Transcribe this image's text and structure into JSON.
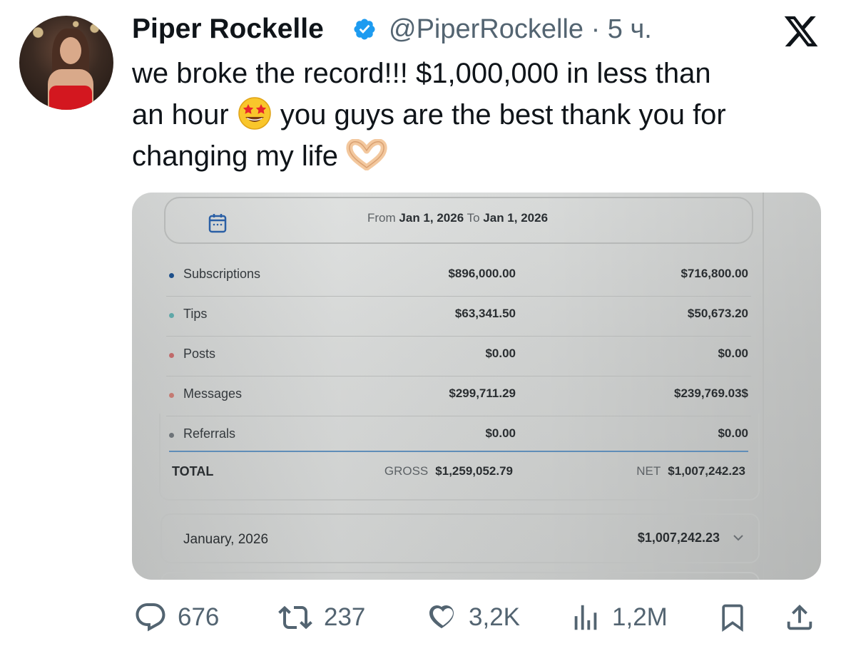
{
  "author": {
    "name": "Piper Rockelle",
    "handle": "@PiperRockelle",
    "time": "5 ч.",
    "separator": "·",
    "verified": true
  },
  "tweet": {
    "line1": "we broke the record!!! $1,000,000 in less than",
    "line2_a": "an hour",
    "line2_emoji": "star-struck-emoji",
    "line2_b": "you guys are the best thank you for",
    "line3": "changing my life",
    "line3_emoji": "heart-hands-emoji"
  },
  "media": {
    "date_filter": {
      "from_label": "From",
      "from_date": "Jan 1, 2026",
      "to_label": "To",
      "to_date": "Jan 1, 2026"
    },
    "rows": [
      {
        "label": "Subscriptions",
        "gross": "$896,000.00",
        "net": "$716,800.00",
        "dot_color": "#1d4f8a"
      },
      {
        "label": "Tips",
        "gross": "$63,341.50",
        "net": "$50,673.20",
        "dot_color": "#5fa7a8"
      },
      {
        "label": "Posts",
        "gross": "$0.00",
        "net": "$0.00",
        "dot_color": "#c06a6a"
      },
      {
        "label": "Messages",
        "gross": "$299,711.29",
        "net": "$239,769.03$",
        "dot_color": "#c47a72"
      },
      {
        "label": "Referrals",
        "gross": "$0.00",
        "net": "$0.00",
        "dot_color": "#6d7378"
      }
    ],
    "total": {
      "label": "TOTAL",
      "gross_caption": "GROSS",
      "gross": "$1,259,052.79",
      "net_caption": "NET",
      "net": "$1,007,242.23"
    },
    "month": {
      "label": "January, 2026",
      "total": "$1,007,242.23"
    }
  },
  "actions": {
    "replies": "676",
    "reposts": "237",
    "likes": "3,2K",
    "views": "1,2M"
  },
  "colors": {
    "text": "#0f1419",
    "muted": "#536471",
    "verified": "#1d9bf0"
  }
}
